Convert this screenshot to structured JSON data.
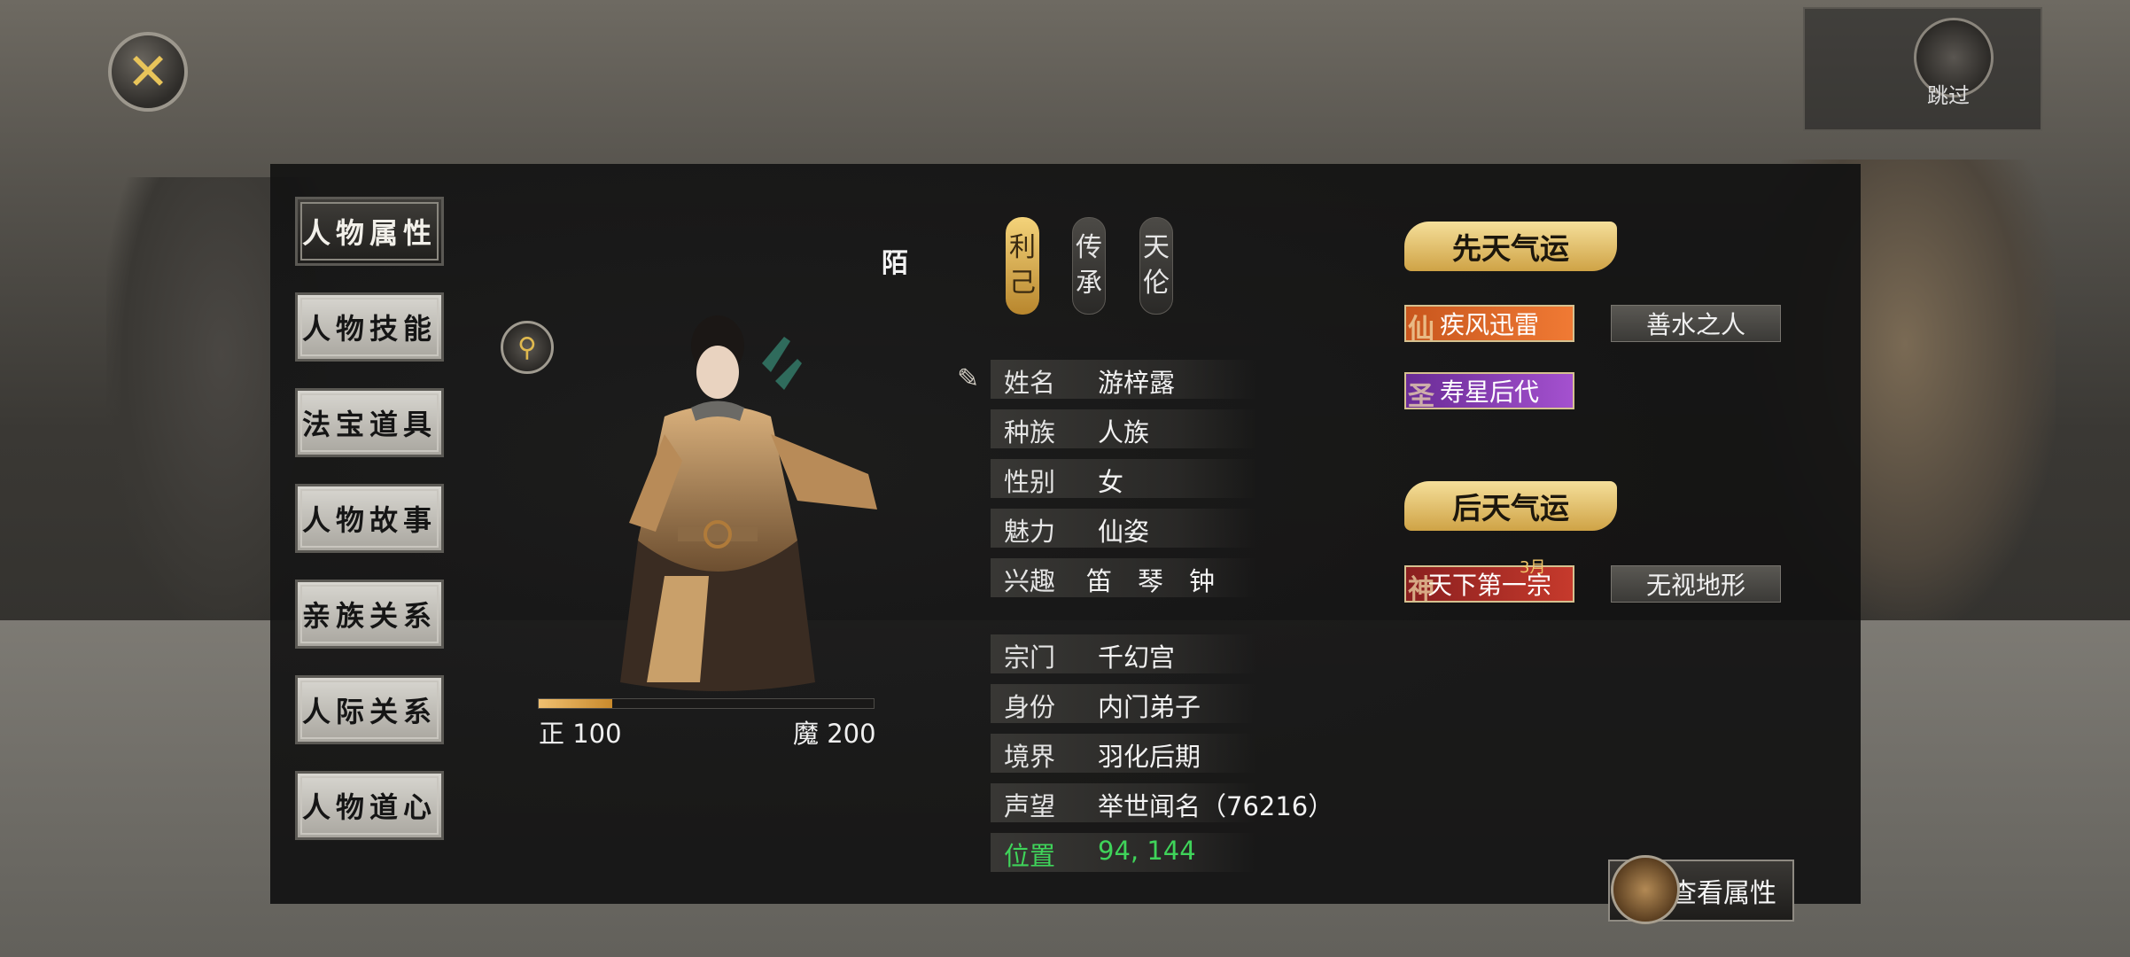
{
  "sidebar": {
    "items": [
      {
        "label": "人物属性",
        "active": true
      },
      {
        "label": "人物技能",
        "active": false
      },
      {
        "label": "法宝道具",
        "active": false
      },
      {
        "label": "人物故事",
        "active": false
      },
      {
        "label": "亲族关系",
        "active": false
      },
      {
        "label": "人际关系",
        "active": false
      },
      {
        "label": "人物道心",
        "active": false
      }
    ]
  },
  "character": {
    "nickname": "陌",
    "morality": {
      "zheng_label": "正 100",
      "mo_label": "魔 200",
      "fill_fraction": 0.22
    }
  },
  "tabs": [
    {
      "label": "利\n己",
      "active": true
    },
    {
      "label": "传\n承",
      "active": false
    },
    {
      "label": "天\n伦",
      "active": false
    }
  ],
  "info": {
    "name": {
      "key": "姓名",
      "value": "游梓露"
    },
    "race": {
      "key": "种族",
      "value": "人族"
    },
    "gender": {
      "key": "性别",
      "value": "女"
    },
    "charm": {
      "key": "魅力",
      "value": "仙姿"
    },
    "hobby": {
      "key": "兴趣",
      "value": "笛　琴　钟"
    },
    "sect": {
      "key": "宗门",
      "value": "千幻宫"
    },
    "status": {
      "key": "身份",
      "value": "内门弟子"
    },
    "realm": {
      "key": "境界",
      "value": "羽化后期"
    },
    "fame": {
      "key": "声望",
      "value": "举世闻名（76216）"
    },
    "location": {
      "key": "位置",
      "value": "94, 144"
    }
  },
  "innate_fortune": {
    "title": "先天气运",
    "traits": [
      {
        "label": "疾风迅雷",
        "glyph": "仙"
      },
      {
        "label": "善水之人"
      },
      {
        "label": "寿星后代",
        "glyph": "圣"
      }
    ]
  },
  "acquired_fortune": {
    "title": "后天气运",
    "traits": [
      {
        "label": "天下第一宗",
        "glyph": "神",
        "badge": "3月"
      },
      {
        "label": "无视地形"
      }
    ]
  },
  "buttons": {
    "view_attributes": "查看属性",
    "skip": "跳过"
  },
  "colors": {
    "accent_gold": "#e8c45a",
    "location_green": "#3fd45a"
  }
}
